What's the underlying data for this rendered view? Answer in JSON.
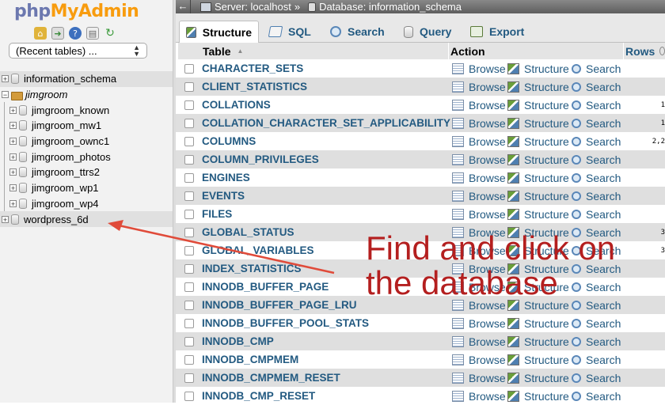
{
  "sidebar": {
    "logo_php": "php",
    "logo_myadmin": "MyAdmin",
    "recent_tables": "(Recent tables) ...",
    "databases": [
      {
        "name": "information_schema",
        "italic": false
      },
      {
        "name": "jimgroom",
        "italic": true
      }
    ],
    "jimgroom_children": [
      "jimgroom_known",
      "jimgroom_mw1",
      "jimgroom_ownc1",
      "jimgroom_photos",
      "jimgroom_ttrs2",
      "jimgroom_wp1",
      "jimgroom_wp4"
    ],
    "last_db": "wordpress_6d"
  },
  "topbar": {
    "back": "←",
    "server": "Server: localhost",
    "separator": "»",
    "database": "Database: information_schema"
  },
  "tabs": [
    {
      "label": "Structure",
      "icon": "structure-icon"
    },
    {
      "label": "SQL",
      "icon": "sql-icon"
    },
    {
      "label": "Search",
      "icon": "search-icon"
    },
    {
      "label": "Query",
      "icon": "query-icon"
    },
    {
      "label": "Export",
      "icon": "export-icon"
    }
  ],
  "table": {
    "col_table": "Table",
    "sort_indicator": "▲",
    "col_action": "Action",
    "col_rows": "Rows",
    "actions": {
      "browse": "Browse",
      "structure": "Structure",
      "search": "Search"
    },
    "rows": [
      {
        "name": "CHARACTER_SETS",
        "rows": ""
      },
      {
        "name": "CLIENT_STATISTICS",
        "rows": ""
      },
      {
        "name": "COLLATIONS",
        "rows": "1"
      },
      {
        "name": "COLLATION_CHARACTER_SET_APPLICABILITY",
        "rows": "1"
      },
      {
        "name": "COLUMNS",
        "rows": "2,2"
      },
      {
        "name": "COLUMN_PRIVILEGES",
        "rows": ""
      },
      {
        "name": "ENGINES",
        "rows": ""
      },
      {
        "name": "EVENTS",
        "rows": ""
      },
      {
        "name": "FILES",
        "rows": ""
      },
      {
        "name": "GLOBAL_STATUS",
        "rows": "3"
      },
      {
        "name": "GLOBAL_VARIABLES",
        "rows": "3"
      },
      {
        "name": "INDEX_STATISTICS",
        "rows": ""
      },
      {
        "name": "INNODB_BUFFER_PAGE",
        "rows": ""
      },
      {
        "name": "INNODB_BUFFER_PAGE_LRU",
        "rows": ""
      },
      {
        "name": "INNODB_BUFFER_POOL_STATS",
        "rows": ""
      },
      {
        "name": "INNODB_CMP",
        "rows": ""
      },
      {
        "name": "INNODB_CMPMEM",
        "rows": ""
      },
      {
        "name": "INNODB_CMPMEM_RESET",
        "rows": ""
      },
      {
        "name": "INNODB_CMP_RESET",
        "rows": ""
      }
    ]
  },
  "annotation": {
    "line1": "Find and click on",
    "line2": "the database",
    "color": "#b41f1f"
  }
}
